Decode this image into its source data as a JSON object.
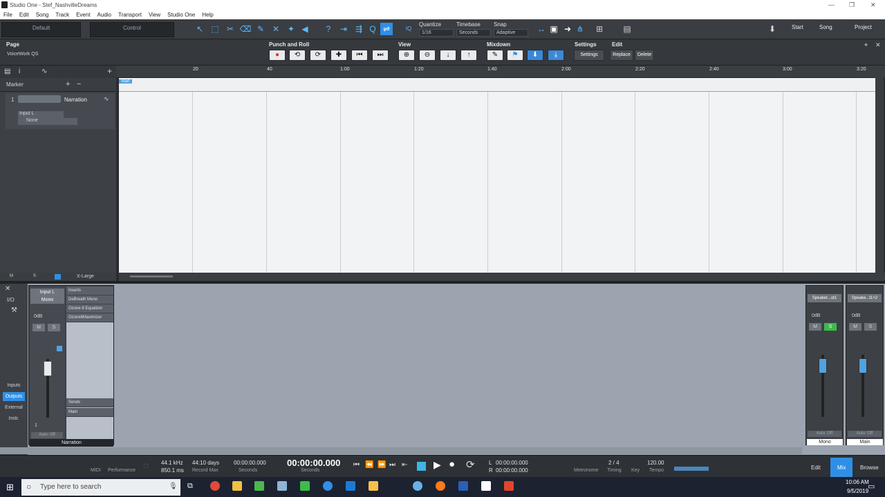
{
  "window": {
    "title": "Studio One - Stef_NashvilleDreams"
  },
  "menu": [
    "File",
    "Edit",
    "Song",
    "Track",
    "Event",
    "Audio",
    "Transport",
    "View",
    "Studio One",
    "Help"
  ],
  "toolbar": {
    "tabs": [
      "Default",
      "Control"
    ],
    "quantize": {
      "label": "Quantize",
      "value": "1/16"
    },
    "timebase": {
      "label": "Timebase",
      "value": "Seconds"
    },
    "snap": {
      "label": "Snap",
      "value": "Adaptive"
    },
    "iq": "IQ",
    "nav": [
      "Start",
      "Song",
      "Project"
    ]
  },
  "row2": {
    "page_label": "Page",
    "preset": "VoiceWork QS",
    "groups": {
      "punch": "Punch and Roll",
      "view": "View",
      "mixdown": "Mixdown",
      "settings": "Settings",
      "edit": "Edit"
    },
    "settings_btn": "Settings",
    "replace_btn": "Replace",
    "delete_btn": "Delete"
  },
  "ruler": {
    "ticks": [
      "20",
      "40",
      "1:00",
      "1:20",
      "1:40",
      "2:00",
      "2:20",
      "2:40",
      "3:00",
      "3:20"
    ]
  },
  "marker": {
    "label": "Marker",
    "start": "Start"
  },
  "track": {
    "number": "1",
    "name": "Narration",
    "input": "Input L",
    "output": "None"
  },
  "leftstrip": {
    "m": "M",
    "s": "S",
    "size": "X-Large"
  },
  "mixer": {
    "io": "I/O",
    "side": [
      "Inputs",
      "Outputs",
      "External",
      "Instr."
    ],
    "channel": {
      "input": "Input L",
      "mode": "Mono",
      "db": "0dB",
      "m": "M",
      "s": "S",
      "num": "1",
      "auto": "Auto: Off",
      "name": "Narration"
    },
    "inserts": {
      "label": "Inserts",
      "items": [
        "DeBreath Mono",
        "Ozone 8 Equalizer",
        "Ozone8Maximizer"
      ]
    },
    "sends": {
      "label": "Sends",
      "items": [
        "Main"
      ]
    },
    "out1": {
      "name": "Speaker...ut1",
      "db": "0dB",
      "m": "M",
      "s": "S",
      "auto": "Auto: Off",
      "label": "Mono"
    },
    "out2": {
      "name": "Speake...t1+2",
      "db": "0dB",
      "m": "M",
      "s": "S",
      "auto": "Auto: Off",
      "label": "Main"
    }
  },
  "transport": {
    "midi": "MIDI",
    "performance": "Performance",
    "rate": "44.1 kHz",
    "latency": "850.1 ms",
    "days": "44:10 days",
    "recmax": "Record Max",
    "time1": "00:00:00.000",
    "time1_lbl": "Seconds",
    "time2": "00:00:00.000",
    "time2_lbl": "Seconds",
    "loopL": "00:00:00.000",
    "loopR": "00:00:00.000",
    "L": "L",
    "R": "R",
    "metronome": "Metronome",
    "timing": "Timing",
    "sig": "2 / 4",
    "key": "Key",
    "tempo": "120.00",
    "tempo_lbl": "Tempo",
    "edit": "Edit",
    "mix": "Mix",
    "browse": "Browse"
  },
  "taskbar": {
    "search_placeholder": "Type here to search",
    "time": "10:06 AM",
    "date": "9/5/2019"
  },
  "colors": {
    "accent": "#2f8fe6",
    "solo": "#3dbb4a",
    "record": "#d83a2c"
  }
}
